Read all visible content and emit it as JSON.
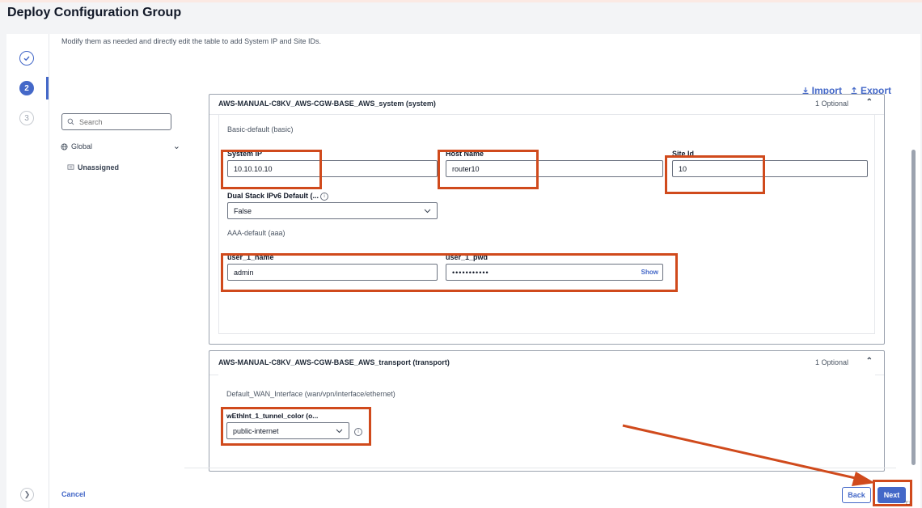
{
  "header": {
    "title": "Deploy Configuration Group"
  },
  "instructions": "Modify them as needed and directly edit the table to add System IP and Site IDs.",
  "stepper": {
    "step2": "2",
    "step3": "3"
  },
  "toolbar": {
    "import_label": "Import",
    "export_label": "Export"
  },
  "tree": {
    "search_placeholder": "Search",
    "global_label": "Global",
    "unassigned_label": "Unassigned"
  },
  "system_card": {
    "title": "AWS-MANUAL-C8KV_AWS-CGW-BASE_AWS_system (system)",
    "optional": "1 Optional",
    "basic_section": "Basic-default (basic)",
    "system_ip": {
      "label": "System IP",
      "value": "10.10.10.10"
    },
    "host_name": {
      "label": "Host Name",
      "value": "router10"
    },
    "site_id": {
      "label": "Site Id",
      "value": "10"
    },
    "dual_stack": {
      "label": "Dual Stack IPv6 Default (...",
      "value": "False"
    },
    "aaa_section": "AAA-default (aaa)",
    "user_name": {
      "label": "user_1_name",
      "value": "admin"
    },
    "user_pwd": {
      "label": "user_1_pwd",
      "value": "•••••••••••",
      "show_label": "Show"
    }
  },
  "transport_card": {
    "title": "AWS-MANUAL-C8KV_AWS-CGW-BASE_AWS_transport (transport)",
    "optional": "1 Optional",
    "wan_section": "Default_WAN_Interface (wan/vpn/interface/ethernet)",
    "tunnel_color": {
      "label": "wEthInt_1_tunnel_color (o...",
      "value": "public-internet"
    }
  },
  "footer": {
    "cancel_label": "Cancel",
    "back_label": "Back",
    "next_label": "Next"
  },
  "colors": {
    "accent": "#4468c8",
    "highlight": "#d04a1c"
  }
}
